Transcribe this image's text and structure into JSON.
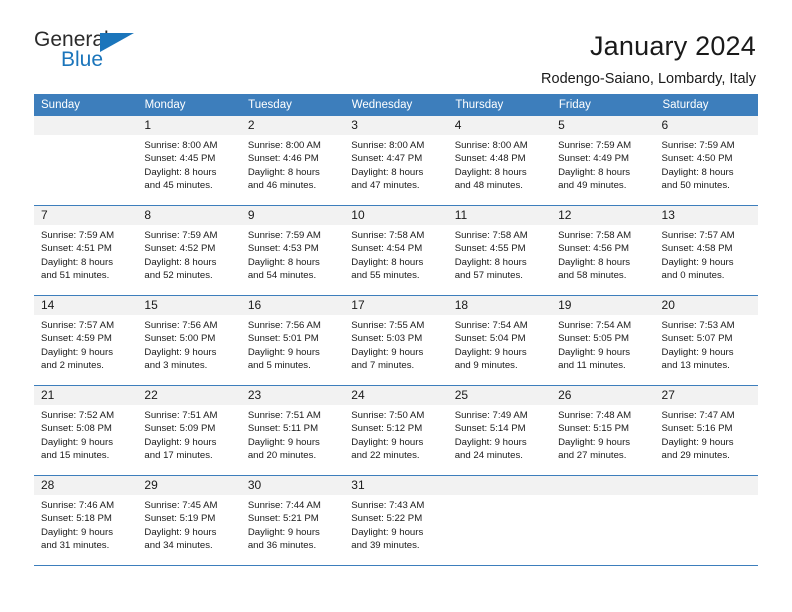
{
  "logo": {
    "word_top": "General",
    "word_bottom": "Blue",
    "triangle_icon": "triangle-icon",
    "color_dark": "#2b2b2b",
    "color_blue": "#1b75bb"
  },
  "header": {
    "title": "January 2024",
    "subtitle": "Rodengo-Saiano, Lombardy, Italy"
  },
  "theme": {
    "header_bg": "#3d7ebc",
    "header_text": "#ffffff",
    "daynum_bg": "#f2f2f2",
    "cell_bg": "#ffffff",
    "text": "#1a1a1a"
  },
  "weekdays": [
    "Sunday",
    "Monday",
    "Tuesday",
    "Wednesday",
    "Thursday",
    "Friday",
    "Saturday"
  ],
  "weeks": [
    [
      {
        "day": "",
        "lines": []
      },
      {
        "day": "1",
        "lines": [
          "Sunrise: 8:00 AM",
          "Sunset: 4:45 PM",
          "Daylight: 8 hours",
          "and 45 minutes."
        ]
      },
      {
        "day": "2",
        "lines": [
          "Sunrise: 8:00 AM",
          "Sunset: 4:46 PM",
          "Daylight: 8 hours",
          "and 46 minutes."
        ]
      },
      {
        "day": "3",
        "lines": [
          "Sunrise: 8:00 AM",
          "Sunset: 4:47 PM",
          "Daylight: 8 hours",
          "and 47 minutes."
        ]
      },
      {
        "day": "4",
        "lines": [
          "Sunrise: 8:00 AM",
          "Sunset: 4:48 PM",
          "Daylight: 8 hours",
          "and 48 minutes."
        ]
      },
      {
        "day": "5",
        "lines": [
          "Sunrise: 7:59 AM",
          "Sunset: 4:49 PM",
          "Daylight: 8 hours",
          "and 49 minutes."
        ]
      },
      {
        "day": "6",
        "lines": [
          "Sunrise: 7:59 AM",
          "Sunset: 4:50 PM",
          "Daylight: 8 hours",
          "and 50 minutes."
        ]
      }
    ],
    [
      {
        "day": "7",
        "lines": [
          "Sunrise: 7:59 AM",
          "Sunset: 4:51 PM",
          "Daylight: 8 hours",
          "and 51 minutes."
        ]
      },
      {
        "day": "8",
        "lines": [
          "Sunrise: 7:59 AM",
          "Sunset: 4:52 PM",
          "Daylight: 8 hours",
          "and 52 minutes."
        ]
      },
      {
        "day": "9",
        "lines": [
          "Sunrise: 7:59 AM",
          "Sunset: 4:53 PM",
          "Daylight: 8 hours",
          "and 54 minutes."
        ]
      },
      {
        "day": "10",
        "lines": [
          "Sunrise: 7:58 AM",
          "Sunset: 4:54 PM",
          "Daylight: 8 hours",
          "and 55 minutes."
        ]
      },
      {
        "day": "11",
        "lines": [
          "Sunrise: 7:58 AM",
          "Sunset: 4:55 PM",
          "Daylight: 8 hours",
          "and 57 minutes."
        ]
      },
      {
        "day": "12",
        "lines": [
          "Sunrise: 7:58 AM",
          "Sunset: 4:56 PM",
          "Daylight: 8 hours",
          "and 58 minutes."
        ]
      },
      {
        "day": "13",
        "lines": [
          "Sunrise: 7:57 AM",
          "Sunset: 4:58 PM",
          "Daylight: 9 hours",
          "and 0 minutes."
        ]
      }
    ],
    [
      {
        "day": "14",
        "lines": [
          "Sunrise: 7:57 AM",
          "Sunset: 4:59 PM",
          "Daylight: 9 hours",
          "and 2 minutes."
        ]
      },
      {
        "day": "15",
        "lines": [
          "Sunrise: 7:56 AM",
          "Sunset: 5:00 PM",
          "Daylight: 9 hours",
          "and 3 minutes."
        ]
      },
      {
        "day": "16",
        "lines": [
          "Sunrise: 7:56 AM",
          "Sunset: 5:01 PM",
          "Daylight: 9 hours",
          "and 5 minutes."
        ]
      },
      {
        "day": "17",
        "lines": [
          "Sunrise: 7:55 AM",
          "Sunset: 5:03 PM",
          "Daylight: 9 hours",
          "and 7 minutes."
        ]
      },
      {
        "day": "18",
        "lines": [
          "Sunrise: 7:54 AM",
          "Sunset: 5:04 PM",
          "Daylight: 9 hours",
          "and 9 minutes."
        ]
      },
      {
        "day": "19",
        "lines": [
          "Sunrise: 7:54 AM",
          "Sunset: 5:05 PM",
          "Daylight: 9 hours",
          "and 11 minutes."
        ]
      },
      {
        "day": "20",
        "lines": [
          "Sunrise: 7:53 AM",
          "Sunset: 5:07 PM",
          "Daylight: 9 hours",
          "and 13 minutes."
        ]
      }
    ],
    [
      {
        "day": "21",
        "lines": [
          "Sunrise: 7:52 AM",
          "Sunset: 5:08 PM",
          "Daylight: 9 hours",
          "and 15 minutes."
        ]
      },
      {
        "day": "22",
        "lines": [
          "Sunrise: 7:51 AM",
          "Sunset: 5:09 PM",
          "Daylight: 9 hours",
          "and 17 minutes."
        ]
      },
      {
        "day": "23",
        "lines": [
          "Sunrise: 7:51 AM",
          "Sunset: 5:11 PM",
          "Daylight: 9 hours",
          "and 20 minutes."
        ]
      },
      {
        "day": "24",
        "lines": [
          "Sunrise: 7:50 AM",
          "Sunset: 5:12 PM",
          "Daylight: 9 hours",
          "and 22 minutes."
        ]
      },
      {
        "day": "25",
        "lines": [
          "Sunrise: 7:49 AM",
          "Sunset: 5:14 PM",
          "Daylight: 9 hours",
          "and 24 minutes."
        ]
      },
      {
        "day": "26",
        "lines": [
          "Sunrise: 7:48 AM",
          "Sunset: 5:15 PM",
          "Daylight: 9 hours",
          "and 27 minutes."
        ]
      },
      {
        "day": "27",
        "lines": [
          "Sunrise: 7:47 AM",
          "Sunset: 5:16 PM",
          "Daylight: 9 hours",
          "and 29 minutes."
        ]
      }
    ],
    [
      {
        "day": "28",
        "lines": [
          "Sunrise: 7:46 AM",
          "Sunset: 5:18 PM",
          "Daylight: 9 hours",
          "and 31 minutes."
        ]
      },
      {
        "day": "29",
        "lines": [
          "Sunrise: 7:45 AM",
          "Sunset: 5:19 PM",
          "Daylight: 9 hours",
          "and 34 minutes."
        ]
      },
      {
        "day": "30",
        "lines": [
          "Sunrise: 7:44 AM",
          "Sunset: 5:21 PM",
          "Daylight: 9 hours",
          "and 36 minutes."
        ]
      },
      {
        "day": "31",
        "lines": [
          "Sunrise: 7:43 AM",
          "Sunset: 5:22 PM",
          "Daylight: 9 hours",
          "and 39 minutes."
        ]
      },
      {
        "day": "",
        "lines": []
      },
      {
        "day": "",
        "lines": []
      },
      {
        "day": "",
        "lines": []
      }
    ]
  ]
}
